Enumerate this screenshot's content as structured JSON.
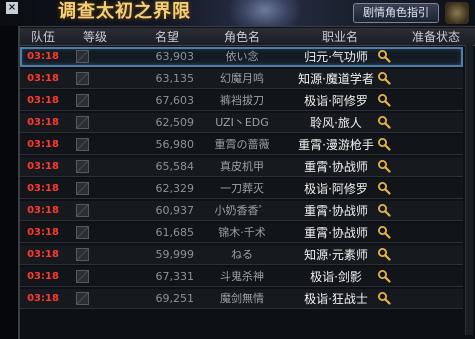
{
  "banner": {
    "close_glyph": "×",
    "title": "调查太初之界限",
    "button_label": "剧情角色指引"
  },
  "table": {
    "headers": {
      "team": "队伍",
      "level": "等级",
      "fame": "名望",
      "name": "角色名",
      "job": "职业名",
      "ready": "准备状态"
    },
    "rows": [
      {
        "team": "03:18",
        "fame": "63,903",
        "name": "依い念",
        "job": "归元·气功师",
        "ready": ""
      },
      {
        "team": "03:18",
        "fame": "63,135",
        "name": "幻魔月鸣",
        "job": "知源·魔道学者",
        "ready": ""
      },
      {
        "team": "03:18",
        "fame": "67,603",
        "name": "裤裆拔刀",
        "job": "极诣·阿修罗",
        "ready": ""
      },
      {
        "team": "03:18",
        "fame": "62,509",
        "name": "UZI丶EDG",
        "job": "聆风·旅人",
        "ready": ""
      },
      {
        "team": "03:18",
        "fame": "56,980",
        "name": "重霄の蔷薇",
        "job": "重霄·漫游枪手",
        "ready": ""
      },
      {
        "team": "03:18",
        "fame": "65,584",
        "name": "真皮机甲",
        "job": "重霄·协战师",
        "ready": ""
      },
      {
        "team": "03:18",
        "fame": "62,329",
        "name": "一刀葬灭",
        "job": "极诣·阿修罗",
        "ready": ""
      },
      {
        "team": "03:18",
        "fame": "60,937",
        "name": "小奶香香゜",
        "job": "重霄·协战师",
        "ready": ""
      },
      {
        "team": "03:18",
        "fame": "61,685",
        "name": "锦木·千术",
        "job": "重霄·协战师",
        "ready": ""
      },
      {
        "team": "03:18",
        "fame": "59,999",
        "name": "ねる",
        "job": "知源·元素师",
        "ready": ""
      },
      {
        "team": "03:18",
        "fame": "67,331",
        "name": "斗鬼杀神",
        "job": "极诣·剑影",
        "ready": ""
      },
      {
        "team": "03:18",
        "fame": "69,251",
        "name": "魔剑無情",
        "job": "极诣·狂战士",
        "ready": ""
      }
    ],
    "selected_row_index": 0
  },
  "colors": {
    "team_text": "#ff3a2e",
    "selection_outline": "#4f7fa8",
    "title_gold": "#f2d07a"
  }
}
